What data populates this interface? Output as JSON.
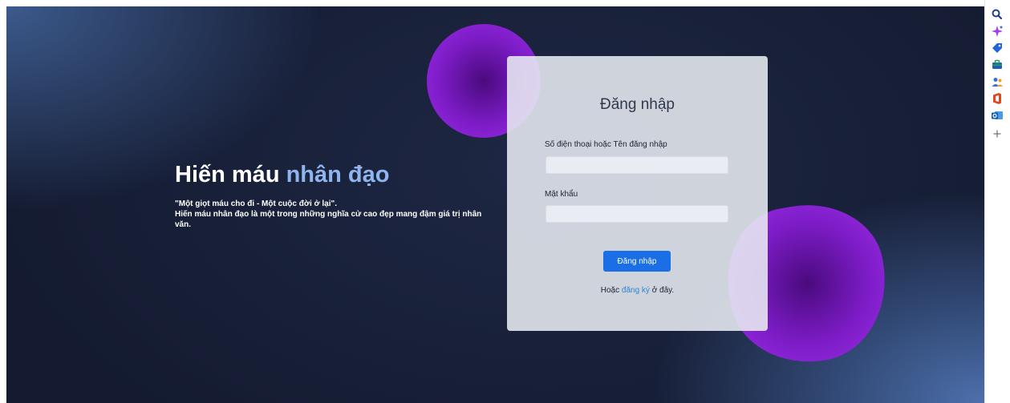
{
  "hero": {
    "title_part1": "Hiến máu",
    "title_part2": "nhân đạo",
    "quote": "\"Một giọt máu cho đi - Một cuộc đời ở lại\".",
    "description": "Hiến máu nhân đạo là một trong những nghĩa cử cao đẹp mang đậm giá trị nhân văn."
  },
  "login": {
    "title": "Đăng nhập",
    "username_label": "Số điện thoại hoặc Tên đăng nhập",
    "username_value": "",
    "password_label": "Mật khẩu",
    "password_value": "",
    "submit_label": "Đăng nhập",
    "register_prefix": "Hoặc",
    "register_link": "đăng ký",
    "register_suffix": "ở đây."
  },
  "colors": {
    "accent_blue": "#1a6ee6",
    "title_accent": "#8fb4ee",
    "blob_purple": "#7d1cc7",
    "link_blue": "#2a86d6"
  },
  "sidebar": {
    "icons": [
      "search-icon",
      "copilot-sparkle-icon",
      "shopping-tag-icon",
      "tools-briefcase-icon",
      "people-icon",
      "office-icon",
      "outlook-icon",
      "add-icon"
    ]
  }
}
